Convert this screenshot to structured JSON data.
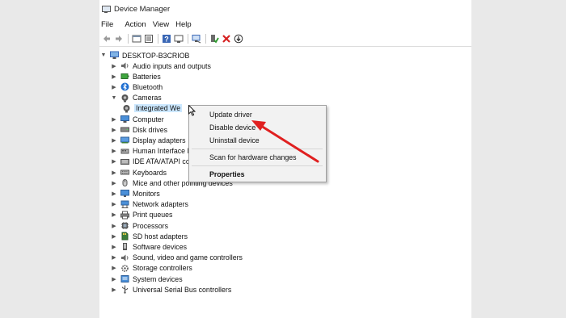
{
  "window": {
    "title": "Device Manager"
  },
  "menu": [
    "File",
    "Action",
    "View",
    "Help"
  ],
  "toolbar": {
    "icons": [
      "back-icon",
      "forward-icon",
      "properties-pane-icon",
      "list-view-icon",
      "help-icon",
      "device-view-icon",
      "scan-hardware-icon",
      "enable-device-icon",
      "uninstall-icon",
      "update-driver-icon"
    ]
  },
  "tree": {
    "root": "DESKTOP-B3CRIOB",
    "items": [
      {
        "label": "Audio inputs and outputs",
        "icon": "speaker-icon"
      },
      {
        "label": "Batteries",
        "icon": "battery-icon"
      },
      {
        "label": "Bluetooth",
        "icon": "bluetooth-icon"
      },
      {
        "label": "Cameras",
        "icon": "camera-icon"
      },
      {
        "label": "Integrated We",
        "icon": "webcam-icon"
      },
      {
        "label": "Computer",
        "icon": "computer-icon"
      },
      {
        "label": "Disk drives",
        "icon": "disk-icon"
      },
      {
        "label": "Display adapters",
        "icon": "display-adapter-icon"
      },
      {
        "label": "Human Interface I",
        "icon": "hid-icon"
      },
      {
        "label": "IDE ATA/ATAPI cor",
        "icon": "ide-icon"
      },
      {
        "label": "Keyboards",
        "icon": "keyboard-icon"
      },
      {
        "label": "Mice and other pointing devices",
        "icon": "mouse-icon"
      },
      {
        "label": "Monitors",
        "icon": "monitor-icon"
      },
      {
        "label": "Network adapters",
        "icon": "network-icon"
      },
      {
        "label": "Print queues",
        "icon": "printer-icon"
      },
      {
        "label": "Processors",
        "icon": "processor-icon"
      },
      {
        "label": "SD host adapters",
        "icon": "sd-icon"
      },
      {
        "label": "Software devices",
        "icon": "software-icon"
      },
      {
        "label": "Sound, video and game controllers",
        "icon": "sound-icon"
      },
      {
        "label": "Storage controllers",
        "icon": "storage-icon"
      },
      {
        "label": "System devices",
        "icon": "system-icon"
      },
      {
        "label": "Universal Serial Bus controllers",
        "icon": "usb-icon"
      }
    ]
  },
  "context_menu": {
    "update": "Update driver",
    "disable": "Disable device",
    "uninstall": "Uninstall device",
    "scan": "Scan for hardware changes",
    "properties": "Properties"
  },
  "annotation": {
    "arrow_color": "#e02020"
  }
}
